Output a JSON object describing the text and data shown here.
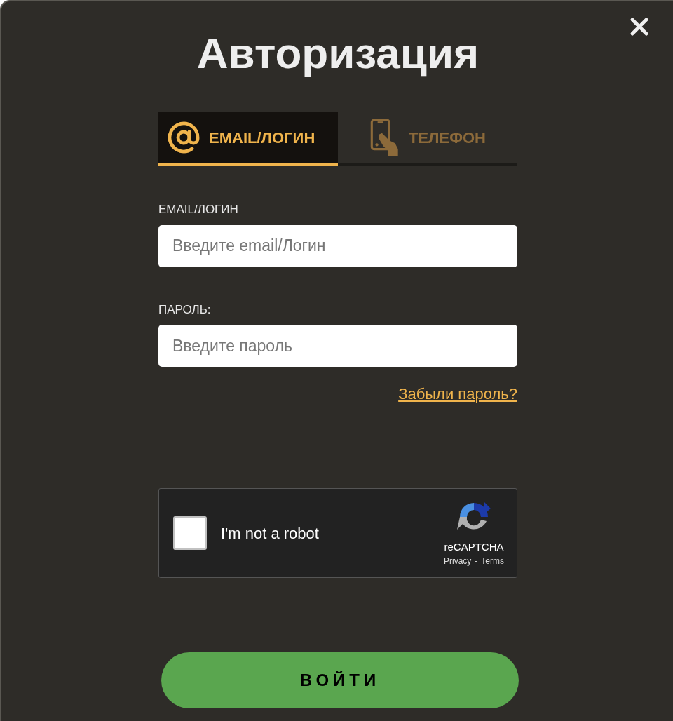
{
  "title": "Авторизация",
  "tabs": [
    {
      "label": "EMAIL/ЛОГИН",
      "kind": "email",
      "selected": true
    },
    {
      "label": "ТЕЛЕФОН",
      "kind": "phone",
      "selected": false
    }
  ],
  "fields": [
    {
      "label": "EMAIL/ЛОГИН",
      "placeholder": "Введите email/Логин"
    },
    {
      "label": "ПАРОЛЬ:",
      "placeholder": "Введите пароль"
    }
  ],
  "forgot_link": "Забыли пароль?",
  "captcha": {
    "checked": false,
    "label": "I'm not a robot",
    "brand": "reCAPTCHA",
    "privacy": "Privacy",
    "separator": "-",
    "terms": "Terms"
  },
  "submit": "ВОЙТИ"
}
